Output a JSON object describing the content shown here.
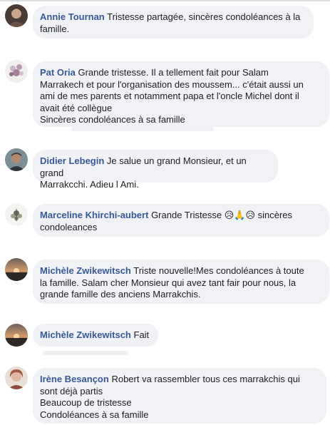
{
  "comments": [
    {
      "author": "Annie Tournan",
      "lines": [
        "Tristesse partagée, sincères condoléances à la",
        "famille."
      ]
    },
    {
      "author": "Pat Oria",
      "lines": [
        "Grande tristesse. Il a tellement fait pour Salam",
        "Marrakech et pour l'organisation des moussem... c'était aussi un",
        "ami de mes parents et notamment papa et l'oncle Michel dont il",
        "avait été collègue",
        "Sincères condoléances à sa famille"
      ]
    },
    {
      "author": "Didier Lebegin",
      "lines": [
        "Je salue un grand Monsieur, et un grand",
        "Marrakcchi. Adieu l Ami."
      ]
    },
    {
      "author": "Marceline Khirchi-aubert",
      "lines": [
        "Grande Tristesse",
        "condoleances"
      ],
      "emojis": [
        "😥",
        "🙏",
        "😥"
      ],
      "after_emojis": "sincères"
    },
    {
      "author": "Michèle Zwikewitsch",
      "lines": [
        "Triste nouvelle!Mes condoléances à toute",
        "la famille. Salam cher Monsieur qui avez tant fair pour nous, la",
        "grande famille des anciens Marrakchis."
      ]
    },
    {
      "author": "Michèle Zwikewitsch",
      "lines": [
        "Fait"
      ]
    },
    {
      "author": "Irène Besançon",
      "lines": [
        "Robert va rassembler tous ces marrakchis qui",
        "sont déjà partis",
        "Beaucoup de tristesse",
        "Condoléances à sa famille"
      ]
    }
  ],
  "colors": {
    "author": "#385898",
    "bubble": "#f0f2f5",
    "text": "#1c1e21"
  }
}
